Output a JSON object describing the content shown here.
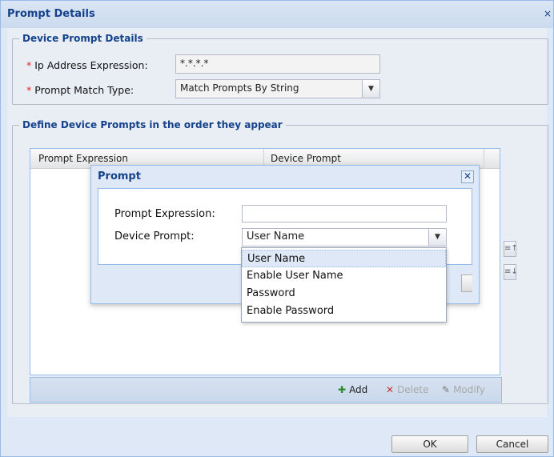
{
  "window": {
    "title": "Prompt Details",
    "close_glyph": "×"
  },
  "device_prompt_details": {
    "legend": "Device Prompt Details",
    "ip_label": "Ip Address Expression:",
    "ip_value": "*.*.*.*",
    "match_label": "Prompt Match Type:",
    "match_value": "Match Prompts By String",
    "required_mark": "*"
  },
  "define_prompts": {
    "legend": "Define Device Prompts in the order they appear",
    "columns": [
      "Prompt Expression",
      "Device Prompt"
    ]
  },
  "toolbar": {
    "add_label": "Add",
    "delete_label": "Delete",
    "modify_label": "Modify"
  },
  "footer": {
    "ok_label": "OK",
    "cancel_label": "Cancel"
  },
  "prompt_dialog": {
    "title": "Prompt",
    "expression_label": "Prompt Expression:",
    "expression_value": "",
    "device_prompt_label": "Device Prompt:",
    "device_prompt_value": "User Name",
    "options": [
      "User Name",
      "Enable User Name",
      "Password",
      "Enable Password"
    ]
  },
  "icons": {
    "add": "plus-icon",
    "delete": "x-icon",
    "modify": "pencil-icon",
    "move_up": "move-up-icon",
    "move_down": "move-down-icon"
  },
  "colors": {
    "title_text": "#15428b",
    "required": "#e02020",
    "add_icon": "#2e8b2e",
    "delete_icon": "#cc3333"
  }
}
